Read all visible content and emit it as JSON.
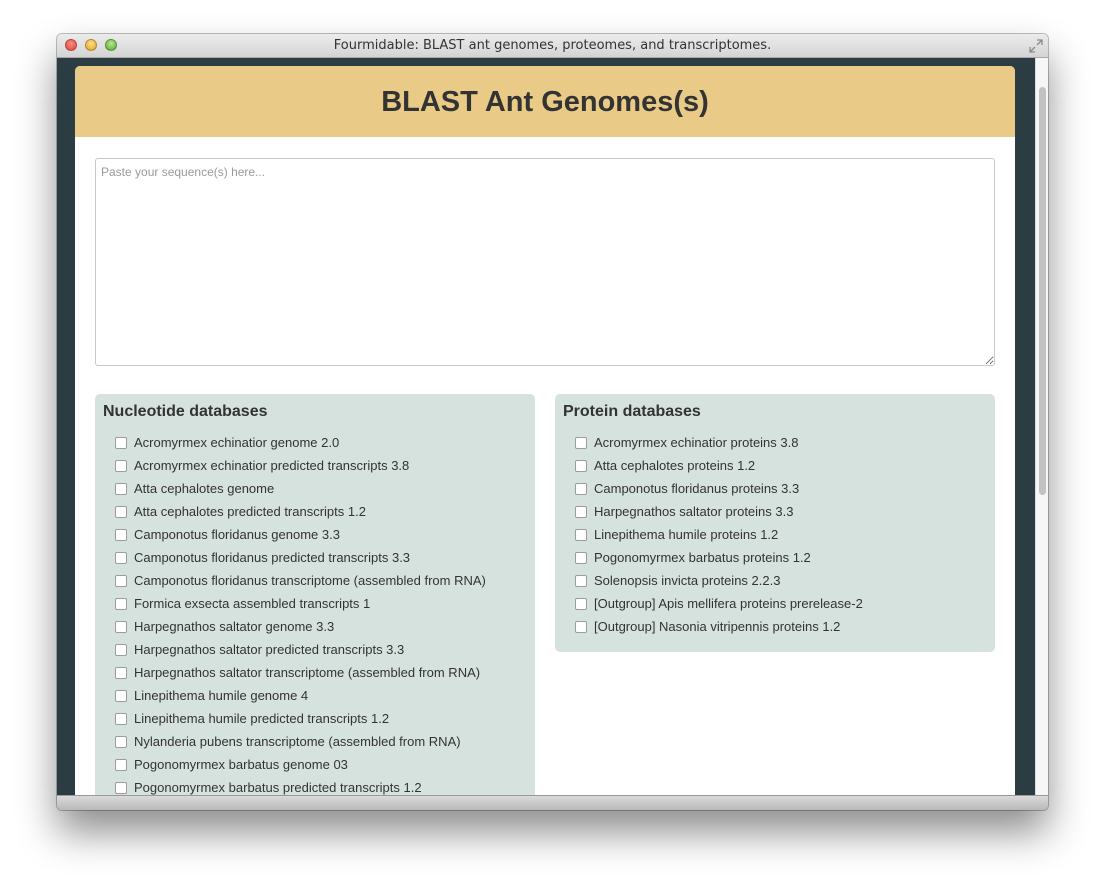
{
  "window": {
    "title": "Fourmidable: BLAST ant genomes, proteomes, and transcriptomes."
  },
  "page": {
    "heading": "BLAST Ant Genomes(s)"
  },
  "sequence_input": {
    "placeholder": "Paste your sequence(s) here...",
    "value": ""
  },
  "nucleotide": {
    "title": "Nucleotide databases",
    "items": [
      {
        "label": "Acromyrmex echinatior genome 2.0",
        "checked": false
      },
      {
        "label": "Acromyrmex echinatior predicted transcripts 3.8",
        "checked": false
      },
      {
        "label": "Atta cephalotes genome",
        "checked": false
      },
      {
        "label": "Atta cephalotes predicted transcripts 1.2",
        "checked": false
      },
      {
        "label": "Camponotus floridanus genome 3.3",
        "checked": false
      },
      {
        "label": "Camponotus floridanus predicted transcripts 3.3",
        "checked": false
      },
      {
        "label": "Camponotus floridanus transcriptome (assembled from RNA)",
        "checked": false
      },
      {
        "label": "Formica exsecta assembled transcripts 1",
        "checked": false
      },
      {
        "label": "Harpegnathos saltator genome 3.3",
        "checked": false
      },
      {
        "label": "Harpegnathos saltator predicted transcripts 3.3",
        "checked": false
      },
      {
        "label": "Harpegnathos saltator transcriptome (assembled from RNA)",
        "checked": false
      },
      {
        "label": "Linepithema humile genome 4",
        "checked": false
      },
      {
        "label": "Linepithema humile predicted transcripts 1.2",
        "checked": false
      },
      {
        "label": "Nylanderia pubens transcriptome (assembled from RNA)",
        "checked": false
      },
      {
        "label": "Pogonomyrmex barbatus genome 03",
        "checked": false
      },
      {
        "label": "Pogonomyrmex barbatus predicted transcripts 1.2",
        "checked": false
      }
    ]
  },
  "protein": {
    "title": "Protein databases",
    "items": [
      {
        "label": "Acromyrmex echinatior proteins 3.8",
        "checked": false
      },
      {
        "label": "Atta cephalotes proteins 1.2",
        "checked": false
      },
      {
        "label": "Camponotus floridanus proteins 3.3",
        "checked": false
      },
      {
        "label": "Harpegnathos saltator proteins 3.3",
        "checked": false
      },
      {
        "label": "Linepithema humile proteins 1.2",
        "checked": false
      },
      {
        "label": "Pogonomyrmex barbatus proteins 1.2",
        "checked": false
      },
      {
        "label": "Solenopsis invicta proteins 2.2.3",
        "checked": false
      },
      {
        "label": "[Outgroup] Apis mellifera proteins prerelease-2",
        "checked": false
      },
      {
        "label": "[Outgroup] Nasonia vitripennis proteins 1.2",
        "checked": false
      }
    ]
  },
  "colors": {
    "background": "#2b3d42",
    "header": "#e9cb87",
    "db_box": "#d6e2dd"
  }
}
